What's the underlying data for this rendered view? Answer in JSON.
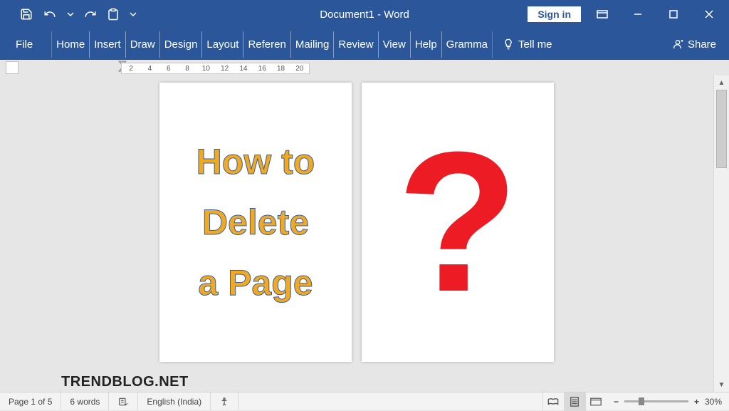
{
  "title": "Document1  -  Word",
  "sign_in": "Sign in",
  "tabs": {
    "file": "File",
    "home": "Home",
    "insert": "Insert",
    "draw": "Draw",
    "design": "Design",
    "layout": "Layout",
    "references": "Referen",
    "mailings": "Mailing",
    "review": "Review",
    "view": "View",
    "help": "Help",
    "grammar": "Gramma"
  },
  "tell_me": "Tell me",
  "share": "Share",
  "ruler": [
    "2",
    "4",
    "6",
    "8",
    "10",
    "12",
    "14",
    "16",
    "18",
    "20"
  ],
  "page1_lines": [
    "How to",
    "Delete",
    "a Page"
  ],
  "page2_symbol": "?",
  "status": {
    "page": "Page 1 of 5",
    "words": "6 words",
    "language": "English (India)",
    "zoom": "30%"
  },
  "watermark": "TRENDBLOG.NET"
}
